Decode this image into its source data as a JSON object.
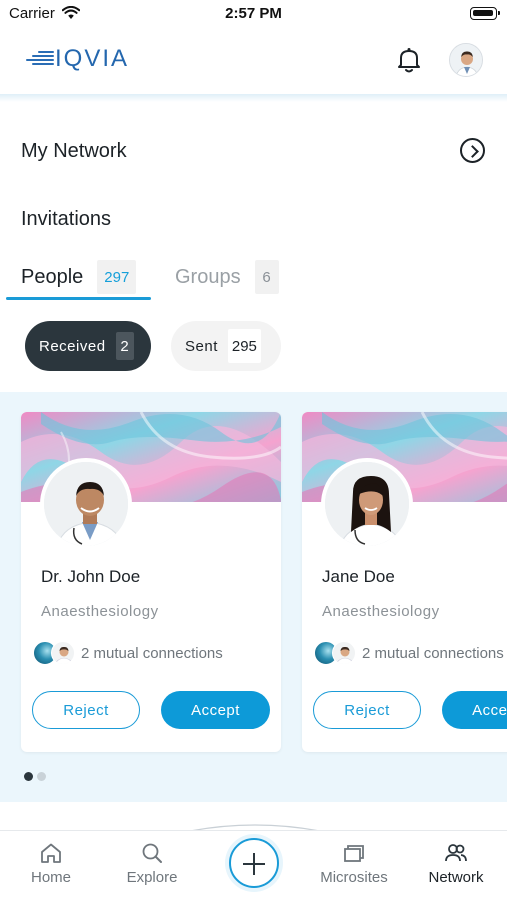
{
  "status_bar": {
    "carrier": "Carrier",
    "time": "2:57 PM"
  },
  "header": {
    "logo_text": "IQVIA",
    "brand_color": "#2467ae"
  },
  "my_network": {
    "title": "My Network"
  },
  "invitations": {
    "title": "Invitations"
  },
  "tabs": [
    {
      "label": "People",
      "count": "297",
      "active": true
    },
    {
      "label": "Groups",
      "count": "6",
      "active": false
    }
  ],
  "filters": [
    {
      "label": "Received",
      "count": "2",
      "active": true
    },
    {
      "label": "Sent",
      "count": "295",
      "active": false
    }
  ],
  "cards": [
    {
      "name": "Dr. John Doe",
      "specialty": "Anaesthesiology",
      "mutual": "2 mutual connections",
      "reject_label": "Reject",
      "accept_label": "Accept"
    },
    {
      "name": "Jane Doe",
      "specialty": "Anaesthesiology",
      "mutual": "2 mutual connections",
      "reject_label": "Reject",
      "accept_label": "Accept"
    }
  ],
  "pager": {
    "total": 2,
    "current": 1
  },
  "bottom_nav": [
    {
      "label": "Home",
      "icon": "home-icon",
      "active": false
    },
    {
      "label": "Explore",
      "icon": "search-icon",
      "active": false
    },
    {
      "label": "Microsites",
      "icon": "microsites-icon",
      "active": false
    },
    {
      "label": "Network",
      "icon": "network-icon",
      "active": true
    }
  ],
  "colors": {
    "accent": "#1a9bd7",
    "dark_pill": "#2b363d",
    "card_area_bg": "#ebf6fc"
  }
}
